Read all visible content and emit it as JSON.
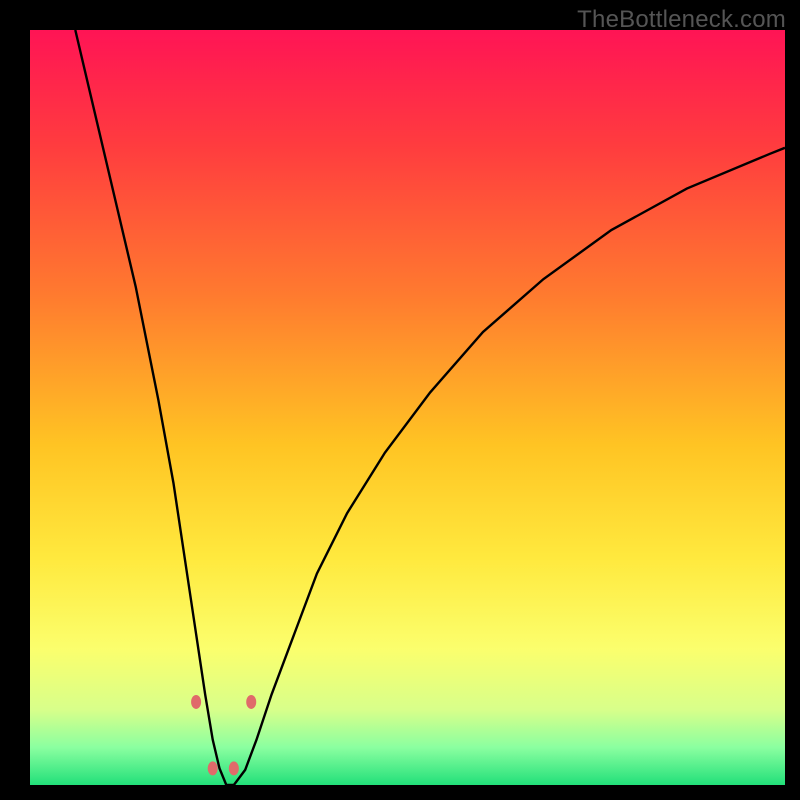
{
  "watermark": "TheBottleneck.com",
  "chart_data": {
    "type": "line",
    "title": "",
    "xlabel": "",
    "ylabel": "",
    "xlim": [
      0,
      100
    ],
    "ylim": [
      0,
      100
    ],
    "background_gradient_stops": [
      {
        "offset": 0,
        "color": "#ff1455"
      },
      {
        "offset": 0.15,
        "color": "#ff3b3f"
      },
      {
        "offset": 0.35,
        "color": "#ff7a2f"
      },
      {
        "offset": 0.55,
        "color": "#ffc423"
      },
      {
        "offset": 0.7,
        "color": "#ffe93e"
      },
      {
        "offset": 0.82,
        "color": "#fbff6d"
      },
      {
        "offset": 0.9,
        "color": "#d8ff8a"
      },
      {
        "offset": 0.95,
        "color": "#8bffa0"
      },
      {
        "offset": 1.0,
        "color": "#22e07a"
      }
    ],
    "series": [
      {
        "name": "bottleneck-curve",
        "color": "#000000",
        "x": [
          6,
          10,
          14,
          17,
          19,
          20.5,
          22,
          23.2,
          24.2,
          25.1,
          26,
          27,
          28.5,
          30,
          32,
          35,
          38,
          42,
          47,
          53,
          60,
          68,
          77,
          87,
          98,
          100
        ],
        "y": [
          100,
          83,
          66,
          51,
          40,
          30,
          20,
          12,
          6,
          2.2,
          0,
          0,
          2,
          6,
          12,
          20,
          28,
          36,
          44,
          52,
          60,
          67,
          73.5,
          79,
          83.6,
          84.4
        ]
      }
    ],
    "markers": {
      "color": "#e06a6a",
      "rx": 5,
      "ry": 7,
      "points": [
        {
          "x": 22.0,
          "y": 11.0
        },
        {
          "x": 24.2,
          "y": 2.2
        },
        {
          "x": 27.0,
          "y": 2.2
        },
        {
          "x": 29.3,
          "y": 11.0
        }
      ]
    }
  }
}
